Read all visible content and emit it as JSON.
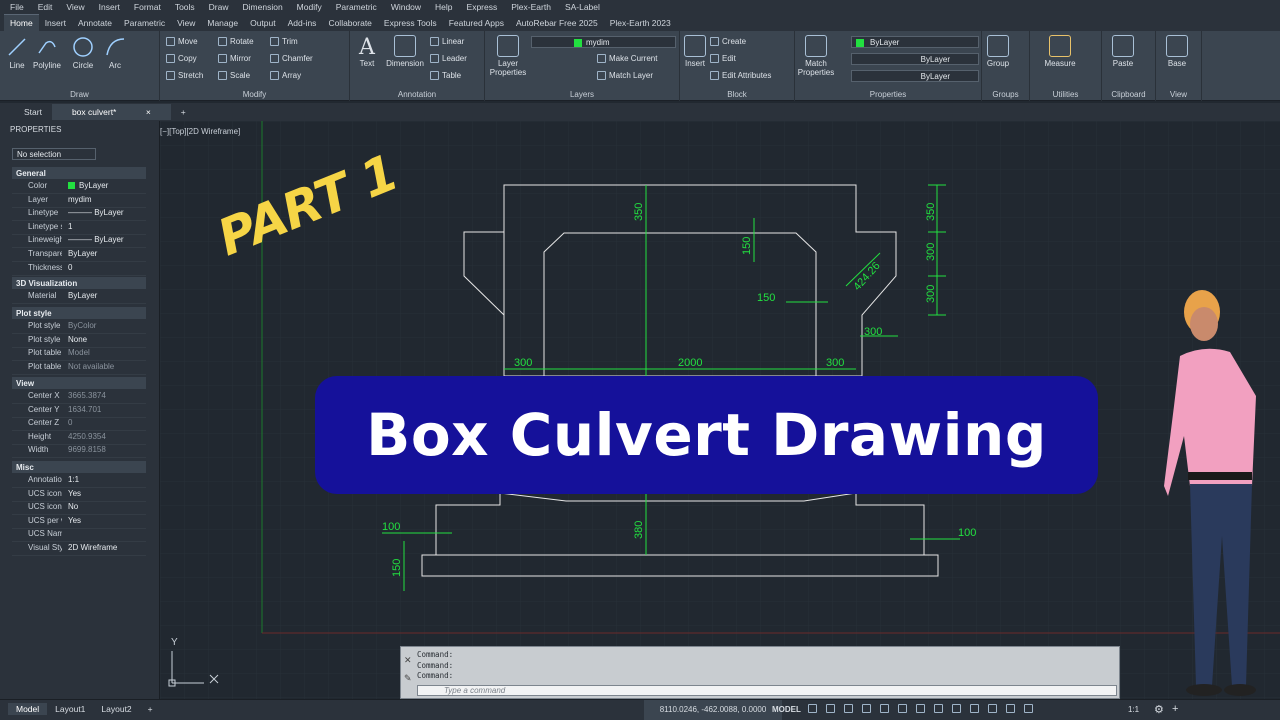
{
  "menu": [
    "File",
    "Edit",
    "View",
    "Insert",
    "Format",
    "Tools",
    "Draw",
    "Dimension",
    "Modify",
    "Parametric",
    "Window",
    "Help",
    "Express",
    "Plex-Earth",
    "SA-Label"
  ],
  "ribbon_tabs": [
    "Home",
    "Insert",
    "Annotate",
    "Parametric",
    "View",
    "Manage",
    "Output",
    "Add-ins",
    "Collaborate",
    "Express Tools",
    "Featured Apps",
    "AutoRebar Free 2025",
    "Plex-Earth 2023"
  ],
  "ribbon": {
    "draw": {
      "title": "Draw",
      "line": "Line",
      "polyline": "Polyline",
      "circle": "Circle",
      "arc": "Arc"
    },
    "modify": {
      "title": "Modify",
      "move": "Move",
      "rotate": "Rotate",
      "trim": "Trim",
      "copy": "Copy",
      "mirror": "Mirror",
      "chamfer": "Chamfer",
      "stretch": "Stretch",
      "scale": "Scale",
      "array": "Array"
    },
    "annotation": {
      "title": "Annotation",
      "text": "Text",
      "dimension": "Dimension",
      "linear": "Linear",
      "leader": "Leader",
      "table": "Table"
    },
    "layers": {
      "title": "Layers",
      "layer_properties": "Layer Properties",
      "current_layer": "mydim",
      "make_current": "Make Current",
      "match_layer": "Match Layer"
    },
    "block": {
      "title": "Block",
      "insert": "Insert",
      "create": "Create",
      "edit": "Edit",
      "edit_attributes": "Edit Attributes"
    },
    "properties": {
      "title": "Properties",
      "match": "Match Properties",
      "color": "ByLayer",
      "linetype": "ByLayer",
      "lineweight": "ByLayer"
    },
    "groups": {
      "title": "Groups",
      "group": "Group"
    },
    "utilities": {
      "title": "Utilities",
      "measure": "Measure"
    },
    "clipboard": {
      "title": "Clipboard",
      "paste": "Paste"
    },
    "view": {
      "title": "View",
      "base": "Base"
    }
  },
  "doc_tabs": {
    "start": "Start",
    "active": "box culvert*",
    "close": "×",
    "add": "+"
  },
  "properties": {
    "header": "PROPERTIES",
    "selection": "No selection",
    "general": {
      "title": "General",
      "rows": [
        [
          "Color",
          "ByLayer"
        ],
        [
          "Layer",
          "mydim"
        ],
        [
          "Linetype",
          "——— ByLayer"
        ],
        [
          "Linetype s...",
          "1"
        ],
        [
          "Lineweight",
          "——— ByLayer"
        ],
        [
          "Transpare...",
          "ByLayer"
        ],
        [
          "Thickness",
          "0"
        ]
      ]
    },
    "viz": {
      "title": "3D Visualization",
      "rows": [
        [
          "Material",
          "ByLayer"
        ]
      ]
    },
    "plot": {
      "title": "Plot style",
      "rows": [
        [
          "Plot style",
          "ByColor"
        ],
        [
          "Plot style t...",
          "None"
        ],
        [
          "Plot table...",
          "Model"
        ],
        [
          "Plot table...",
          "Not available"
        ]
      ]
    },
    "view": {
      "title": "View",
      "rows": [
        [
          "Center X",
          "3665.3874"
        ],
        [
          "Center Y",
          "1634.701"
        ],
        [
          "Center Z",
          "0"
        ],
        [
          "Height",
          "4250.9354"
        ],
        [
          "Width",
          "9699.8158"
        ]
      ]
    },
    "misc": {
      "title": "Misc",
      "rows": [
        [
          "Annotatio...",
          "1:1"
        ],
        [
          "UCS icon...",
          "Yes"
        ],
        [
          "UCS icon...",
          "No"
        ],
        [
          "UCS per vi...",
          "Yes"
        ],
        [
          "UCS Name",
          ""
        ],
        [
          "Visual Style",
          "2D Wireframe"
        ]
      ]
    }
  },
  "viewport_label": "[−][Top][2D Wireframe]",
  "dims": {
    "d350a": "350",
    "d150a": "150",
    "d150b": "150",
    "d424": "424.26",
    "d350b": "350",
    "d300a": "300",
    "d300b": "300",
    "d300c": "300",
    "d300l": "300",
    "d2000": "2000",
    "d300r": "300",
    "d100l": "100",
    "d100r": "100",
    "d380": "380",
    "d150c": "150"
  },
  "overlay": {
    "part": "PART 1",
    "banner": "Box Culvert Drawing"
  },
  "command": {
    "lines": [
      "Command:",
      "Command:",
      "Command:"
    ],
    "placeholder": "Type a command"
  },
  "ucs": {
    "y": "Y"
  },
  "status": {
    "tabs": [
      "Model",
      "Layout1",
      "Layout2"
    ],
    "coords": "8110.0246, -462.0088, 0.0000",
    "model": "MODEL",
    "scale": "1:1"
  },
  "colors": {
    "dim": "#22e040",
    "geometry": "#e6e6e6",
    "banner": "#15119a",
    "part": "#f6d546"
  }
}
